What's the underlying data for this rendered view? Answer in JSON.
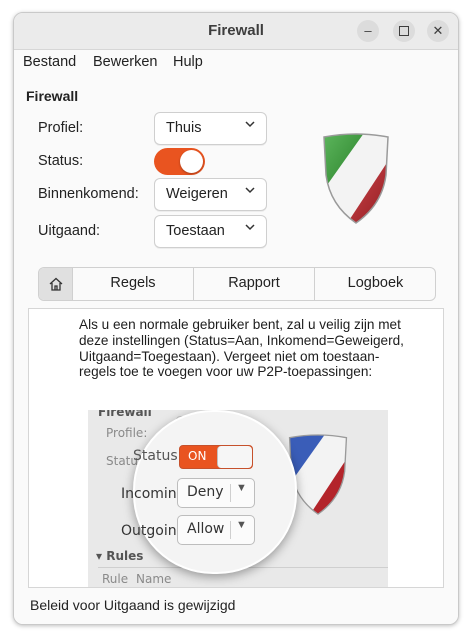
{
  "window": {
    "title": "Firewall"
  },
  "menu": [
    "Bestand",
    "Bewerken",
    "Hulp"
  ],
  "section_title": "Firewall",
  "form": {
    "profile_label": "Profiel:",
    "profile_value": "Thuis",
    "status_label": "Status:",
    "status_on": true,
    "incoming_label": "Binnenkomend:",
    "incoming_value": "Weigeren",
    "outgoing_label": "Uitgaand:",
    "outgoing_value": "Toestaan"
  },
  "tabs": [
    "Regels",
    "Rapport",
    "Logboek"
  ],
  "content": {
    "description": "Als u een normale gebruiker bent, zal u veilig zijn met deze instellingen (Status=Aan, Inkomend=Geweigerd, Uitgaand=Toegestaan). Vergeet niet om toestaan-regels toe te voegen voor uw P2P-toepassingen:",
    "illustration": {
      "window_title": "Firewall",
      "profile_label": "Profile:",
      "status_label": "Status:",
      "incoming_label": "Incoming:",
      "outgoing_label": "Outgoing:",
      "toggle_label": "ON",
      "incoming_value": "Deny",
      "outgoing_value": "Allow",
      "rules_label": "Rules",
      "col_rule": "Rule",
      "col_name": "Name"
    }
  },
  "statusbar": {
    "text": "Beleid voor Uitgaand is gewijzigd"
  },
  "colors": {
    "accent": "#e95420",
    "shield_green": "#3a8f3a",
    "shield_red": "#b3242a"
  }
}
